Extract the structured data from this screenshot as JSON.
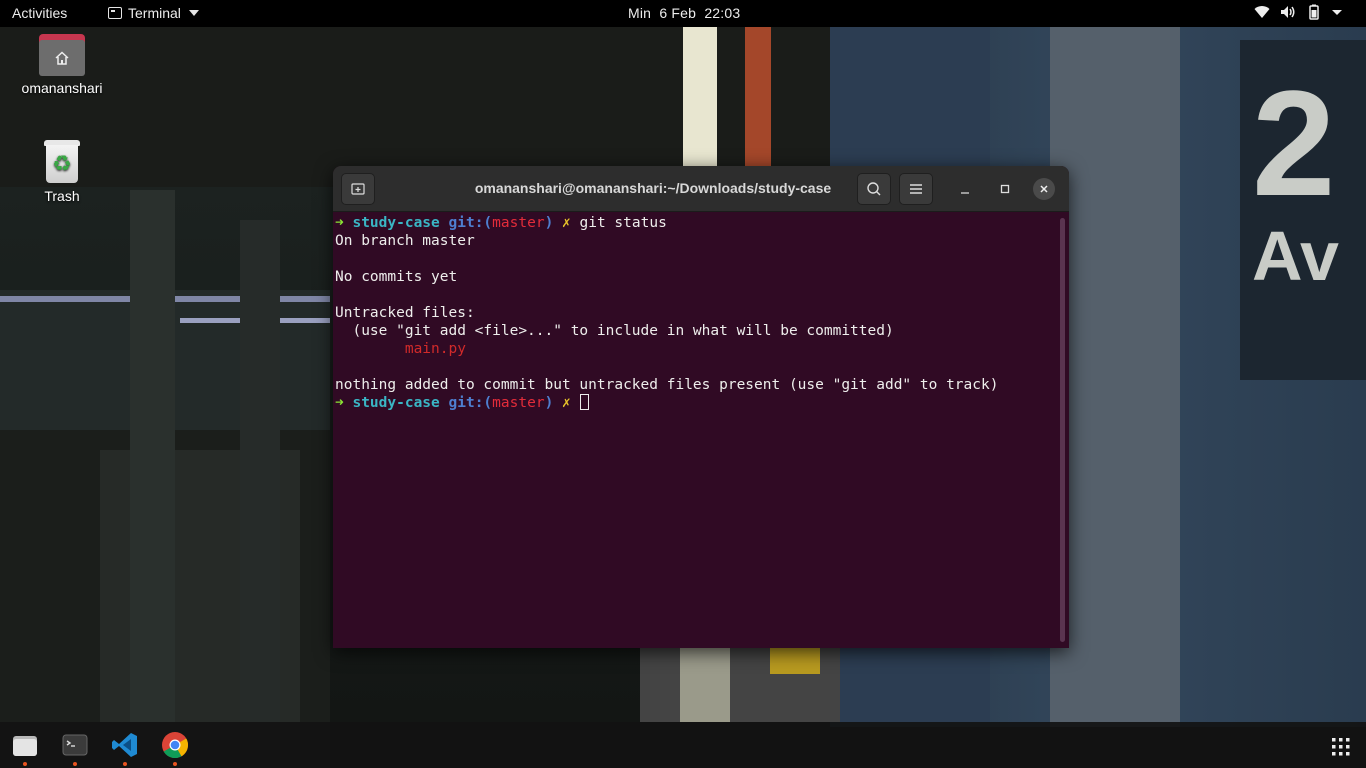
{
  "topbar": {
    "activities": "Activities",
    "app_name": "Terminal",
    "clock": "Min  6 Feb  22:03"
  },
  "desktop": {
    "home_label": "omananshari",
    "trash_label": "Trash"
  },
  "terminal": {
    "title": "omananshari@omananshari:~/Downloads/study-case",
    "prompt_arrow": "➜",
    "prompt_dir": "study-case",
    "prompt_git": "git:(",
    "prompt_branch": "master",
    "prompt_git_close": ")",
    "prompt_x": "✗",
    "command": "git status",
    "output": {
      "line1": "On branch master",
      "line2": "No commits yet",
      "line3": "Untracked files:",
      "line4": "  (use \"git add <file>...\" to include in what will be committed)",
      "untracked_file": "main.py",
      "line6": "nothing added to commit but untracked files present (use \"git add\" to track)"
    }
  },
  "colors": {
    "terminal_bg": "#300a24",
    "prompt_arrow": "#8ae234",
    "untracked": "#cc0000",
    "accent_dot": "#e95420"
  },
  "dock": {
    "items": [
      "files-icon",
      "terminal-icon",
      "vscode-icon",
      "chrome-icon"
    ]
  }
}
